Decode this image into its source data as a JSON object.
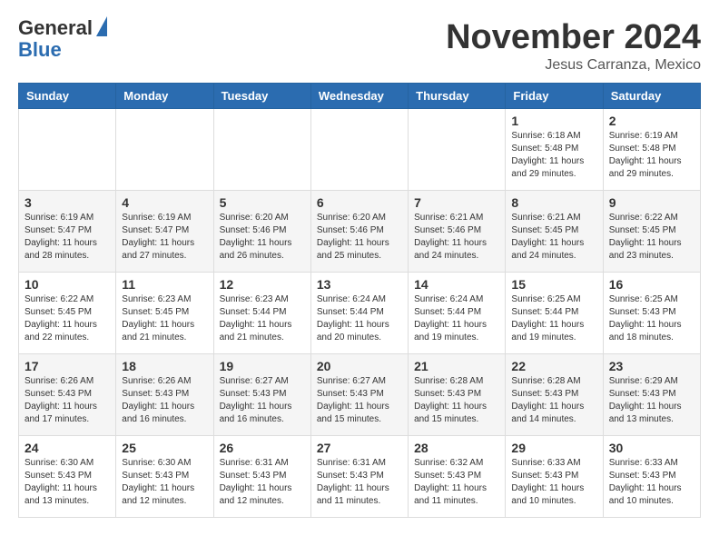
{
  "header": {
    "logo_general": "General",
    "logo_blue": "Blue",
    "month_title": "November 2024",
    "location": "Jesus Carranza, Mexico"
  },
  "days_of_week": [
    "Sunday",
    "Monday",
    "Tuesday",
    "Wednesday",
    "Thursday",
    "Friday",
    "Saturday"
  ],
  "weeks": [
    [
      {
        "day": "",
        "info": ""
      },
      {
        "day": "",
        "info": ""
      },
      {
        "day": "",
        "info": ""
      },
      {
        "day": "",
        "info": ""
      },
      {
        "day": "",
        "info": ""
      },
      {
        "day": "1",
        "info": "Sunrise: 6:18 AM\nSunset: 5:48 PM\nDaylight: 11 hours and 29 minutes."
      },
      {
        "day": "2",
        "info": "Sunrise: 6:19 AM\nSunset: 5:48 PM\nDaylight: 11 hours and 29 minutes."
      }
    ],
    [
      {
        "day": "3",
        "info": "Sunrise: 6:19 AM\nSunset: 5:47 PM\nDaylight: 11 hours and 28 minutes."
      },
      {
        "day": "4",
        "info": "Sunrise: 6:19 AM\nSunset: 5:47 PM\nDaylight: 11 hours and 27 minutes."
      },
      {
        "day": "5",
        "info": "Sunrise: 6:20 AM\nSunset: 5:46 PM\nDaylight: 11 hours and 26 minutes."
      },
      {
        "day": "6",
        "info": "Sunrise: 6:20 AM\nSunset: 5:46 PM\nDaylight: 11 hours and 25 minutes."
      },
      {
        "day": "7",
        "info": "Sunrise: 6:21 AM\nSunset: 5:46 PM\nDaylight: 11 hours and 24 minutes."
      },
      {
        "day": "8",
        "info": "Sunrise: 6:21 AM\nSunset: 5:45 PM\nDaylight: 11 hours and 24 minutes."
      },
      {
        "day": "9",
        "info": "Sunrise: 6:22 AM\nSunset: 5:45 PM\nDaylight: 11 hours and 23 minutes."
      }
    ],
    [
      {
        "day": "10",
        "info": "Sunrise: 6:22 AM\nSunset: 5:45 PM\nDaylight: 11 hours and 22 minutes."
      },
      {
        "day": "11",
        "info": "Sunrise: 6:23 AM\nSunset: 5:45 PM\nDaylight: 11 hours and 21 minutes."
      },
      {
        "day": "12",
        "info": "Sunrise: 6:23 AM\nSunset: 5:44 PM\nDaylight: 11 hours and 21 minutes."
      },
      {
        "day": "13",
        "info": "Sunrise: 6:24 AM\nSunset: 5:44 PM\nDaylight: 11 hours and 20 minutes."
      },
      {
        "day": "14",
        "info": "Sunrise: 6:24 AM\nSunset: 5:44 PM\nDaylight: 11 hours and 19 minutes."
      },
      {
        "day": "15",
        "info": "Sunrise: 6:25 AM\nSunset: 5:44 PM\nDaylight: 11 hours and 19 minutes."
      },
      {
        "day": "16",
        "info": "Sunrise: 6:25 AM\nSunset: 5:43 PM\nDaylight: 11 hours and 18 minutes."
      }
    ],
    [
      {
        "day": "17",
        "info": "Sunrise: 6:26 AM\nSunset: 5:43 PM\nDaylight: 11 hours and 17 minutes."
      },
      {
        "day": "18",
        "info": "Sunrise: 6:26 AM\nSunset: 5:43 PM\nDaylight: 11 hours and 16 minutes."
      },
      {
        "day": "19",
        "info": "Sunrise: 6:27 AM\nSunset: 5:43 PM\nDaylight: 11 hours and 16 minutes."
      },
      {
        "day": "20",
        "info": "Sunrise: 6:27 AM\nSunset: 5:43 PM\nDaylight: 11 hours and 15 minutes."
      },
      {
        "day": "21",
        "info": "Sunrise: 6:28 AM\nSunset: 5:43 PM\nDaylight: 11 hours and 15 minutes."
      },
      {
        "day": "22",
        "info": "Sunrise: 6:28 AM\nSunset: 5:43 PM\nDaylight: 11 hours and 14 minutes."
      },
      {
        "day": "23",
        "info": "Sunrise: 6:29 AM\nSunset: 5:43 PM\nDaylight: 11 hours and 13 minutes."
      }
    ],
    [
      {
        "day": "24",
        "info": "Sunrise: 6:30 AM\nSunset: 5:43 PM\nDaylight: 11 hours and 13 minutes."
      },
      {
        "day": "25",
        "info": "Sunrise: 6:30 AM\nSunset: 5:43 PM\nDaylight: 11 hours and 12 minutes."
      },
      {
        "day": "26",
        "info": "Sunrise: 6:31 AM\nSunset: 5:43 PM\nDaylight: 11 hours and 12 minutes."
      },
      {
        "day": "27",
        "info": "Sunrise: 6:31 AM\nSunset: 5:43 PM\nDaylight: 11 hours and 11 minutes."
      },
      {
        "day": "28",
        "info": "Sunrise: 6:32 AM\nSunset: 5:43 PM\nDaylight: 11 hours and 11 minutes."
      },
      {
        "day": "29",
        "info": "Sunrise: 6:33 AM\nSunset: 5:43 PM\nDaylight: 11 hours and 10 minutes."
      },
      {
        "day": "30",
        "info": "Sunrise: 6:33 AM\nSunset: 5:43 PM\nDaylight: 11 hours and 10 minutes."
      }
    ]
  ]
}
